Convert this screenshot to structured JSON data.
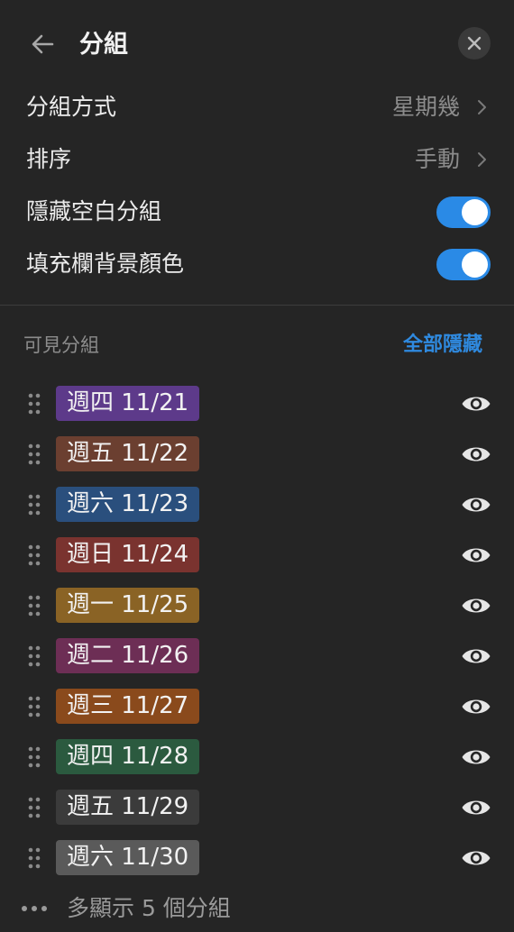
{
  "header": {
    "title": "分組",
    "back_icon": "arrow-left-icon",
    "close_icon": "close-icon"
  },
  "settings": {
    "group_by": {
      "label": "分組方式",
      "value": "星期幾"
    },
    "sort": {
      "label": "排序",
      "value": "手動"
    },
    "hide_empty": {
      "label": "隱藏空白分組",
      "on": true
    },
    "fill_background": {
      "label": "填充欄背景顏色",
      "on": true
    }
  },
  "visible_groups": {
    "section_label": "可見分組",
    "hide_all_label": "全部隱藏",
    "items": [
      {
        "label": "週四 11/21",
        "color": "#5d3a8a"
      },
      {
        "label": "週五 11/22",
        "color": "#6b3f30"
      },
      {
        "label": "週六 11/23",
        "color": "#2a4f7d"
      },
      {
        "label": "週日 11/24",
        "color": "#7a332f"
      },
      {
        "label": "週一 11/25",
        "color": "#8a6325"
      },
      {
        "label": "週二 11/26",
        "color": "#6d2e55"
      },
      {
        "label": "週三 11/27",
        "color": "#8a4a1c"
      },
      {
        "label": "週四 11/28",
        "color": "#2b5a3f"
      },
      {
        "label": "週五 11/29",
        "color": "#3b3b3b"
      },
      {
        "label": "週六 11/30",
        "color": "#5a5a5a"
      }
    ]
  },
  "more": {
    "label": "多顯示 5 個分組"
  },
  "colors": {
    "accent": "#2a8ae6",
    "background": "#252525",
    "text_muted": "#8c8c8c"
  }
}
